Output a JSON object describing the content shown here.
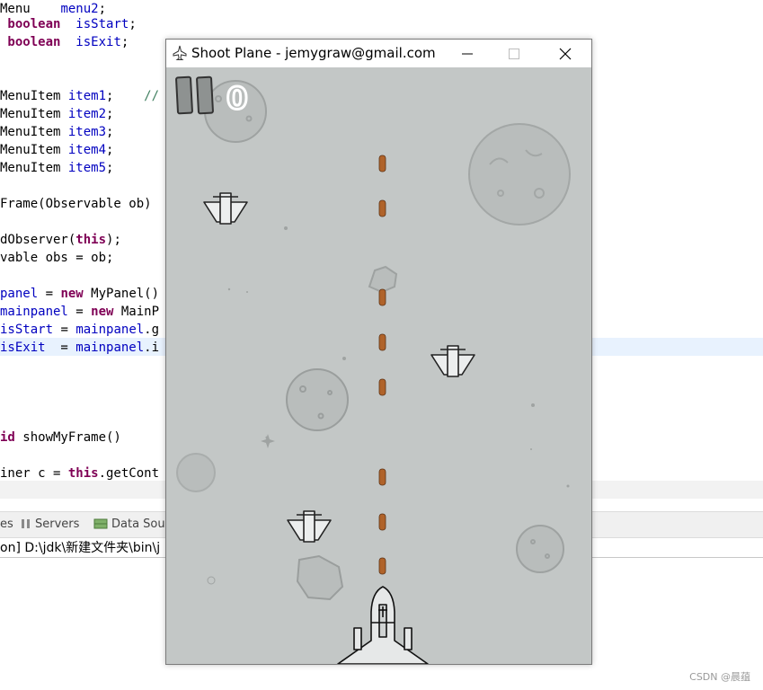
{
  "editor": {
    "lines": [
      {
        "segments": [
          {
            "t": "Menu    ",
            "c": ""
          },
          {
            "t": "menu2",
            "c": "fld"
          },
          {
            "t": ";",
            "c": ""
          }
        ]
      },
      {
        "segments": [
          {
            "t": " boolean",
            "c": "kw"
          },
          {
            "t": "  ",
            "c": ""
          },
          {
            "t": "isStart",
            "c": "fld"
          },
          {
            "t": ";",
            "c": ""
          }
        ]
      },
      {
        "segments": [
          {
            "t": " boolean",
            "c": "kw"
          },
          {
            "t": "  ",
            "c": ""
          },
          {
            "t": "isExit",
            "c": "fld"
          },
          {
            "t": ";",
            "c": ""
          }
        ]
      },
      {
        "segments": [
          {
            "t": "MenuItem ",
            "c": ""
          },
          {
            "t": "item1",
            "c": "fld"
          },
          {
            "t": ";    ",
            "c": ""
          },
          {
            "t": "//",
            "c": "cm"
          }
        ]
      },
      {
        "segments": [
          {
            "t": "MenuItem ",
            "c": ""
          },
          {
            "t": "item2",
            "c": "fld"
          },
          {
            "t": ";",
            "c": ""
          }
        ]
      },
      {
        "segments": [
          {
            "t": "MenuItem ",
            "c": ""
          },
          {
            "t": "item3",
            "c": "fld"
          },
          {
            "t": ";",
            "c": ""
          }
        ]
      },
      {
        "segments": [
          {
            "t": "MenuItem ",
            "c": ""
          },
          {
            "t": "item4",
            "c": "fld"
          },
          {
            "t": ";",
            "c": ""
          }
        ]
      },
      {
        "segments": [
          {
            "t": "MenuItem ",
            "c": ""
          },
          {
            "t": "item5",
            "c": "fld"
          },
          {
            "t": ";",
            "c": ""
          }
        ]
      },
      {
        "segments": [
          {
            "t": "Frame(Observable ob)",
            "c": ""
          }
        ]
      },
      {
        "segments": [
          {
            "t": "dObserver(",
            "c": ""
          },
          {
            "t": "this",
            "c": "kw"
          },
          {
            "t": ");",
            "c": ""
          }
        ]
      },
      {
        "segments": [
          {
            "t": "vable obs = ob;",
            "c": ""
          }
        ]
      },
      {
        "segments": [
          {
            "t": "panel",
            "c": "fld"
          },
          {
            "t": " = ",
            "c": ""
          },
          {
            "t": "new",
            "c": "kw"
          },
          {
            "t": " MyPanel()",
            "c": ""
          }
        ]
      },
      {
        "segments": [
          {
            "t": "mainpanel",
            "c": "fld"
          },
          {
            "t": " = ",
            "c": ""
          },
          {
            "t": "new",
            "c": "kw"
          },
          {
            "t": " MainP",
            "c": ""
          }
        ]
      },
      {
        "segments": [
          {
            "t": "isStart",
            "c": "fld"
          },
          {
            "t": " = ",
            "c": ""
          },
          {
            "t": "mainpanel",
            "c": "fld"
          },
          {
            "t": ".g",
            "c": ""
          }
        ]
      },
      {
        "segments": [
          {
            "t": "isExit",
            "c": "fld"
          },
          {
            "t": "  = ",
            "c": ""
          },
          {
            "t": "mainpanel",
            "c": "fld"
          },
          {
            "t": ".i",
            "c": ""
          }
        ]
      },
      {
        "segments": [
          {
            "t": "id",
            "c": "kw"
          },
          {
            "t": " showMyFrame()",
            "c": ""
          }
        ]
      },
      {
        "segments": [
          {
            "t": "iner c = ",
            "c": ""
          },
          {
            "t": "this",
            "c": "kw"
          },
          {
            "t": ".getCont",
            "c": ""
          }
        ]
      }
    ]
  },
  "views": {
    "items": [
      "es",
      "Servers",
      "Data Sou"
    ]
  },
  "console": {
    "text": "on] D:\\jdk\\新建文件夹\\bin\\j"
  },
  "watermark": "CSDN @晨蕴",
  "window": {
    "title": "Shoot Plane - jemygraw@gmail.com"
  },
  "game": {
    "score": "0",
    "colors": {
      "background": "#c3c7c6",
      "bullet": "#b0632a",
      "outline": "#333333",
      "asteroid": "#aeb2b1"
    },
    "icons": [
      "pause-icon",
      "player-plane-icon",
      "enemy-plane-icon",
      "asteroid-icon",
      "bullet-icon"
    ]
  }
}
